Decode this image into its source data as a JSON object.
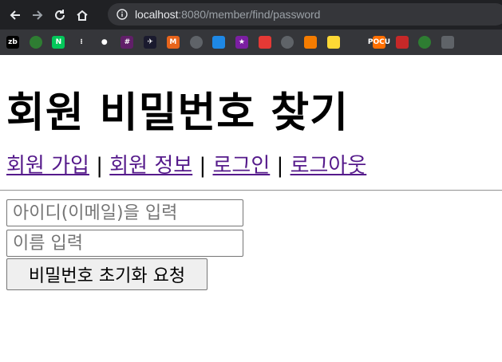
{
  "browser": {
    "url_host": "localhost",
    "url_path": ":8080/member/find/password",
    "bookmarks": [
      {
        "icon": "zb-icon",
        "text": "zb",
        "color": "#000000"
      },
      {
        "icon": "globe-icon",
        "text": "",
        "color": "#2e7d32"
      },
      {
        "icon": "naver-icon",
        "text": "N",
        "color": "#03c75a"
      },
      {
        "icon": "dots-icon",
        "text": "⁝",
        "color": "#35363a"
      },
      {
        "icon": "github-icon",
        "text": "●",
        "color": "#35363a"
      },
      {
        "icon": "slack-icon",
        "text": "#",
        "color": "#611f69"
      },
      {
        "icon": "plane-icon",
        "text": "✈",
        "color": "#1a1a2e"
      },
      {
        "icon": "m-icon",
        "text": "M",
        "color": "#e8641b"
      },
      {
        "icon": "globe-icon",
        "text": "",
        "color": "#5f6368"
      },
      {
        "icon": "image-icon",
        "text": "",
        "color": "#1e88e5"
      },
      {
        "icon": "star-icon",
        "text": "★",
        "color": "#7b1fa2"
      },
      {
        "icon": "ball-icon",
        "text": "",
        "color": "#e53935"
      },
      {
        "icon": "globe-icon",
        "text": "",
        "color": "#5f6368"
      },
      {
        "icon": "fox-icon",
        "text": "",
        "color": "#f57c00"
      },
      {
        "icon": "note-icon",
        "text": "",
        "color": "#fdd835"
      },
      {
        "icon": "figure-icon",
        "text": "",
        "color": "#35363a"
      },
      {
        "icon": "pocu-icon",
        "text": "POCU",
        "color": "#ff6f00"
      },
      {
        "icon": "oracle-icon",
        "text": "",
        "color": "#c62828"
      },
      {
        "icon": "globe-icon",
        "text": "",
        "color": "#2e7d32"
      },
      {
        "icon": "app-icon",
        "text": "",
        "color": "#5f6368"
      }
    ]
  },
  "page": {
    "title": "회원 비밀번호 찾기",
    "links": [
      {
        "label": "회원 가입"
      },
      {
        "label": "회원 정보"
      },
      {
        "label": "로그인"
      },
      {
        "label": "로그아웃"
      }
    ],
    "separator": " | ",
    "form": {
      "email_placeholder": "아이디(이메일)을 입력",
      "name_placeholder": "이름 입력",
      "submit_label": "비밀번호 초기화 요청"
    }
  },
  "colors": {
    "link": "#551a8b",
    "chrome_bg": "#202124",
    "bookmarks_bg": "#35363a"
  }
}
